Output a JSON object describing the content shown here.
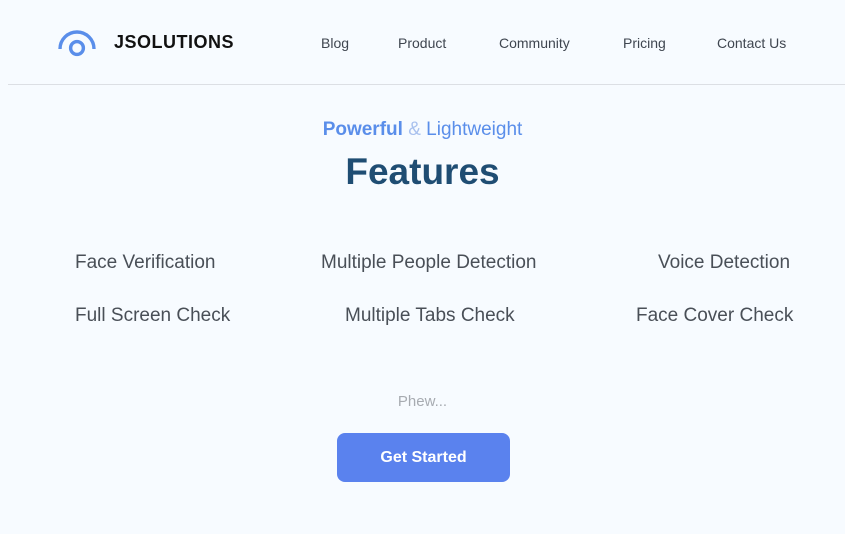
{
  "brand": {
    "name": "JSOLUTIONS",
    "logo_icon": "arc-circle-logo-icon",
    "logo_color": "#5a8eea"
  },
  "nav": {
    "items": [
      {
        "label": "Blog"
      },
      {
        "label": "Product"
      },
      {
        "label": "Community"
      },
      {
        "label": "Pricing"
      },
      {
        "label": "Contact Us"
      }
    ]
  },
  "hero": {
    "eyebrow": {
      "bold": "Powerful",
      "amp": "&",
      "rest": "Lightweight"
    },
    "title": "Features"
  },
  "features": [
    {
      "label": "Face Verification"
    },
    {
      "label": "Multiple People Detection"
    },
    {
      "label": "Voice Detection"
    },
    {
      "label": "Full Screen Check"
    },
    {
      "label": "Multiple Tabs Check"
    },
    {
      "label": "Face Cover Check"
    }
  ],
  "footer_note": "Phew...",
  "cta": {
    "label": "Get Started",
    "color": "#5a82ee"
  },
  "colors": {
    "background": "#f7fbff",
    "heading": "#1f4d73",
    "accent": "#5a8eea",
    "body_text": "#494f57"
  }
}
